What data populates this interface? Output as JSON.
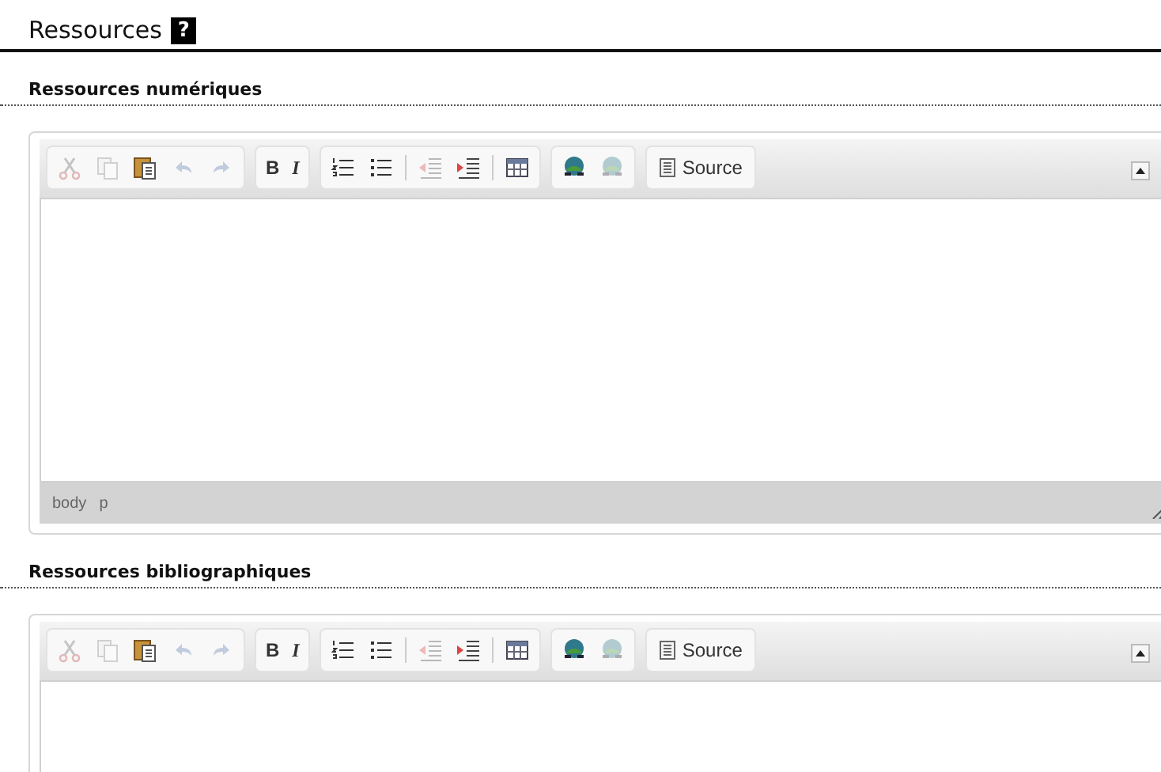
{
  "page_title": "Ressources",
  "help_badge": "?",
  "sections": [
    {
      "heading": "Ressources numériques",
      "editor": {
        "toolbar": [
          [
            {
              "kind": "cut",
              "disabled": true
            },
            {
              "kind": "copy",
              "disabled": true
            },
            {
              "kind": "paste",
              "disabled": false
            },
            {
              "kind": "undo",
              "disabled": true
            },
            {
              "kind": "redo",
              "disabled": true
            }
          ],
          [
            {
              "kind": "bold",
              "label": "B",
              "disabled": false
            },
            {
              "kind": "italic",
              "label": "I",
              "disabled": false
            }
          ],
          [
            {
              "kind": "ordered-list",
              "disabled": false
            },
            {
              "kind": "bulleted-list",
              "disabled": false
            },
            {
              "kind": "separator"
            },
            {
              "kind": "outdent",
              "disabled": true
            },
            {
              "kind": "indent",
              "disabled": false
            },
            {
              "kind": "separator"
            },
            {
              "kind": "table",
              "disabled": false
            }
          ],
          [
            {
              "kind": "link",
              "disabled": false
            },
            {
              "kind": "unlink",
              "disabled": true
            }
          ],
          [
            {
              "kind": "source",
              "label": "Source",
              "disabled": false
            }
          ]
        ],
        "path": [
          "body",
          "p"
        ]
      }
    },
    {
      "heading": "Ressources bibliographiques",
      "editor": {
        "toolbar": [
          [
            {
              "kind": "cut",
              "disabled": true
            },
            {
              "kind": "copy",
              "disabled": true
            },
            {
              "kind": "paste",
              "disabled": false
            },
            {
              "kind": "undo",
              "disabled": true
            },
            {
              "kind": "redo",
              "disabled": true
            }
          ],
          [
            {
              "kind": "bold",
              "label": "B",
              "disabled": false
            },
            {
              "kind": "italic",
              "label": "I",
              "disabled": false
            }
          ],
          [
            {
              "kind": "ordered-list",
              "disabled": false
            },
            {
              "kind": "bulleted-list",
              "disabled": false
            },
            {
              "kind": "separator"
            },
            {
              "kind": "outdent",
              "disabled": true
            },
            {
              "kind": "indent",
              "disabled": false
            },
            {
              "kind": "separator"
            },
            {
              "kind": "table",
              "disabled": false
            }
          ],
          [
            {
              "kind": "link",
              "disabled": false
            },
            {
              "kind": "unlink",
              "disabled": true
            }
          ],
          [
            {
              "kind": "source",
              "label": "Source",
              "disabled": false
            }
          ]
        ]
      }
    }
  ]
}
